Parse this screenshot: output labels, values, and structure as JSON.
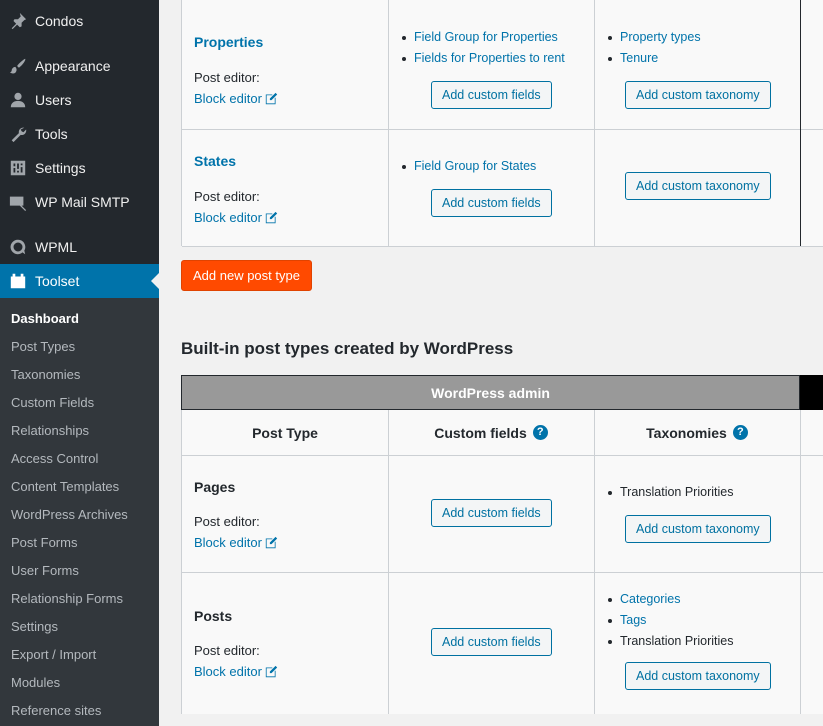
{
  "sidebar": {
    "menu": [
      {
        "label": "Condos",
        "icon": "pin-icon"
      },
      {
        "label": "Appearance",
        "icon": "paintbrush-icon"
      },
      {
        "label": "Users",
        "icon": "user-icon"
      },
      {
        "label": "Tools",
        "icon": "wrench-icon"
      },
      {
        "label": "Settings",
        "icon": "sliders-icon"
      },
      {
        "label": "WP Mail SMTP",
        "icon": "mail-icon"
      },
      {
        "label": "WPML",
        "icon": "wpml-icon"
      },
      {
        "label": "Toolset",
        "icon": "toolset-icon"
      }
    ],
    "submenu": [
      "Dashboard",
      "Post Types",
      "Taxonomies",
      "Custom Fields",
      "Relationships",
      "Access Control",
      "Content Templates",
      "WordPress Archives",
      "Post Forms",
      "User Forms",
      "Relationship Forms",
      "Settings",
      "Export / Import",
      "Modules",
      "Reference sites"
    ]
  },
  "custom_types": [
    {
      "name": "Properties",
      "post_editor_label": "Post editor:",
      "editor_link": "Block editor",
      "fields": [
        "Field Group for Properties",
        "Fields for Properties to rent"
      ],
      "fields_button": "Add custom fields",
      "taxonomies": [
        "Property types",
        "Tenure"
      ],
      "taxonomy_button": "Add custom taxonomy"
    },
    {
      "name": "States",
      "post_editor_label": "Post editor:",
      "editor_link": "Block editor",
      "fields": [
        "Field Group for States"
      ],
      "fields_button": "Add custom fields",
      "taxonomies": [],
      "taxonomy_button": "Add custom taxonomy"
    }
  ],
  "add_post_type_button": "Add new post type",
  "builtin": {
    "heading": "Built-in post types created by WordPress",
    "admin_header": "WordPress admin",
    "columns": {
      "post_type": "Post Type",
      "custom_fields": "Custom fields",
      "taxonomies": "Taxonomies",
      "help": "?"
    },
    "rows": [
      {
        "name": "Pages",
        "post_editor_label": "Post editor:",
        "editor_link": "Block editor",
        "fields_button": "Add custom fields",
        "taxonomies": [
          {
            "label": "Translation Priorities",
            "link": false
          }
        ],
        "taxonomy_button": "Add custom taxonomy"
      },
      {
        "name": "Posts",
        "post_editor_label": "Post editor:",
        "editor_link": "Block editor",
        "fields_button": "Add custom fields",
        "taxonomies": [
          {
            "label": "Categories",
            "link": true
          },
          {
            "label": "Tags",
            "link": true
          },
          {
            "label": "Translation Priorities",
            "link": false
          }
        ],
        "taxonomy_button": "Add custom taxonomy"
      }
    ]
  }
}
